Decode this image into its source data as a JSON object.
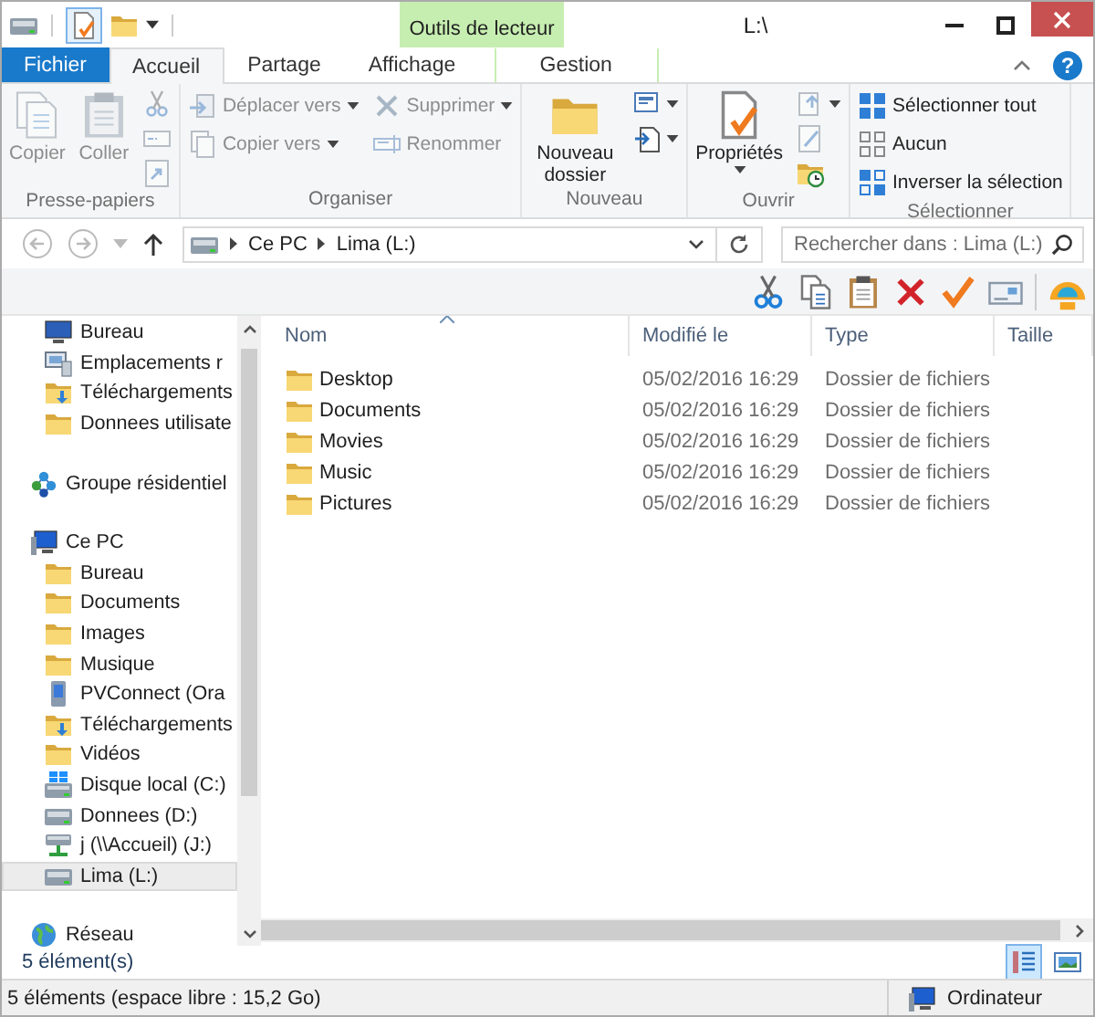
{
  "title_bar": {
    "context_label": "Outils de lecteur",
    "title": "L:\\"
  },
  "ribbon_tabs": [
    {
      "label": "Fichier",
      "kind": "file",
      "selected": false
    },
    {
      "label": "Accueil",
      "kind": "tab",
      "selected": true
    },
    {
      "label": "Partage",
      "kind": "tab",
      "selected": false
    },
    {
      "label": "Affichage",
      "kind": "tab",
      "selected": false
    },
    {
      "label": "Gestion",
      "kind": "context",
      "selected": false
    }
  ],
  "help_button": "?",
  "ribbon_groups": [
    {
      "label": "Presse-papiers",
      "columns": [
        [
          {
            "kind": "large",
            "label": "Copier",
            "disabled": true,
            "dropdown": false
          }
        ],
        [
          {
            "kind": "large",
            "label": "Coller",
            "disabled": true,
            "dropdown": false
          }
        ],
        [
          {
            "kind": "icon",
            "disabled": true,
            "dropdown": false
          },
          {
            "kind": "icon",
            "disabled": true,
            "dropdown": false
          },
          {
            "kind": "icon",
            "disabled": true,
            "dropdown": false
          }
        ]
      ]
    },
    {
      "label": "Organiser",
      "columns": [
        [
          {
            "kind": "small",
            "label": "Déplacer vers",
            "disabled": true,
            "dropdown": true
          },
          {
            "kind": "small",
            "label": "Copier vers",
            "disabled": true,
            "dropdown": true
          }
        ],
        [
          {
            "kind": "small",
            "label": "Supprimer",
            "disabled": true,
            "dropdown": true
          },
          {
            "kind": "small",
            "label": "Renommer",
            "disabled": true,
            "dropdown": false
          }
        ]
      ]
    },
    {
      "label": "Nouveau",
      "columns": [
        [
          {
            "kind": "large",
            "label": "Nouveau dossier",
            "disabled": false,
            "dropdown": false
          }
        ],
        [
          {
            "kind": "icon",
            "disabled": false,
            "dropdown": true
          },
          {
            "kind": "icon",
            "disabled": false,
            "dropdown": true
          }
        ]
      ]
    },
    {
      "label": "Ouvrir",
      "columns": [
        [
          {
            "kind": "large",
            "label": "Propriétés",
            "disabled": false,
            "dropdown": true
          }
        ],
        [
          {
            "kind": "icon",
            "disabled": true,
            "dropdown": true
          },
          {
            "kind": "icon",
            "disabled": true,
            "dropdown": false
          },
          {
            "kind": "icon",
            "disabled": false,
            "dropdown": false
          }
        ]
      ]
    },
    {
      "label": "Sélectionner",
      "columns": [
        [
          {
            "kind": "small",
            "label": "Sélectionner tout",
            "disabled": false,
            "dropdown": false
          },
          {
            "kind": "small",
            "label": "Aucun",
            "disabled": false,
            "dropdown": false
          },
          {
            "kind": "small",
            "label": "Inverser la sélection",
            "disabled": false,
            "dropdown": false
          }
        ]
      ]
    }
  ],
  "nav_buttons": [
    {
      "kind": "back",
      "disabled": true
    },
    {
      "kind": "forward",
      "disabled": true
    },
    {
      "kind": "recent",
      "disabled": true
    },
    {
      "kind": "up",
      "disabled": false
    }
  ],
  "address": {
    "crumbs": [
      "Ce PC",
      "Lima (L:)"
    ]
  },
  "search": {
    "placeholder": "Rechercher dans : Lima (L:)"
  },
  "sidebar": {
    "continued_children": [
      {
        "label": "Bureau",
        "kind": "monitor",
        "selected": false
      },
      {
        "label": "Emplacements r",
        "kind": "computer",
        "selected": false
      },
      {
        "label": "Téléchargements",
        "kind": "download-folder",
        "selected": false
      },
      {
        "label": "Donnees utilisate",
        "kind": "folder",
        "selected": false
      }
    ],
    "items": [
      {
        "label": "Groupe résidentiel",
        "kind": "homegroup",
        "selected": false
      },
      {
        "label": "Ce PC",
        "kind": "pc",
        "selected": false,
        "children": [
          {
            "label": "Bureau",
            "kind": "folder",
            "selected": false
          },
          {
            "label": "Documents",
            "kind": "folder",
            "selected": false
          },
          {
            "label": "Images",
            "kind": "folder",
            "selected": false
          },
          {
            "label": "Musique",
            "kind": "folder",
            "selected": false
          },
          {
            "label": "PVConnect (Ora",
            "kind": "device",
            "selected": false
          },
          {
            "label": "Téléchargements",
            "kind": "download-folder",
            "selected": false
          },
          {
            "label": "Vidéos",
            "kind": "folder",
            "selected": false
          },
          {
            "label": "Disque local (C:)",
            "kind": "system-drive",
            "selected": false
          },
          {
            "label": "Donnees (D:)",
            "kind": "drive",
            "selected": false
          },
          {
            "label": "j (\\\\Accueil) (J:)",
            "kind": "network-drive",
            "selected": false
          },
          {
            "label": "Lima (L:)",
            "kind": "drive",
            "selected": true
          }
        ]
      },
      {
        "label": "Réseau",
        "kind": "network",
        "selected": false
      }
    ]
  },
  "content": {
    "columns": [
      {
        "label": "Nom",
        "sorted": true
      },
      {
        "label": "Modifié le",
        "sorted": false
      },
      {
        "label": "Type",
        "sorted": false
      },
      {
        "label": "Taille",
        "sorted": false
      }
    ],
    "rows": [
      {
        "name": "Desktop",
        "modified": "05/02/2016 16:29",
        "type": "Dossier de fichiers"
      },
      {
        "name": "Documents",
        "modified": "05/02/2016 16:29",
        "type": "Dossier de fichiers"
      },
      {
        "name": "Movies",
        "modified": "05/02/2016 16:29",
        "type": "Dossier de fichiers"
      },
      {
        "name": "Music",
        "modified": "05/02/2016 16:29",
        "type": "Dossier de fichiers"
      },
      {
        "name": "Pictures",
        "modified": "05/02/2016 16:29",
        "type": "Dossier de fichiers"
      }
    ]
  },
  "details_bar": {
    "item_count": "5 élément(s)",
    "views": [
      {
        "kind": "details",
        "selected": true
      },
      {
        "kind": "large-icons",
        "selected": false
      }
    ]
  },
  "status_bar": {
    "text": "5 éléments (espace libre : 15,2 Go)",
    "location": "Ordinateur"
  }
}
